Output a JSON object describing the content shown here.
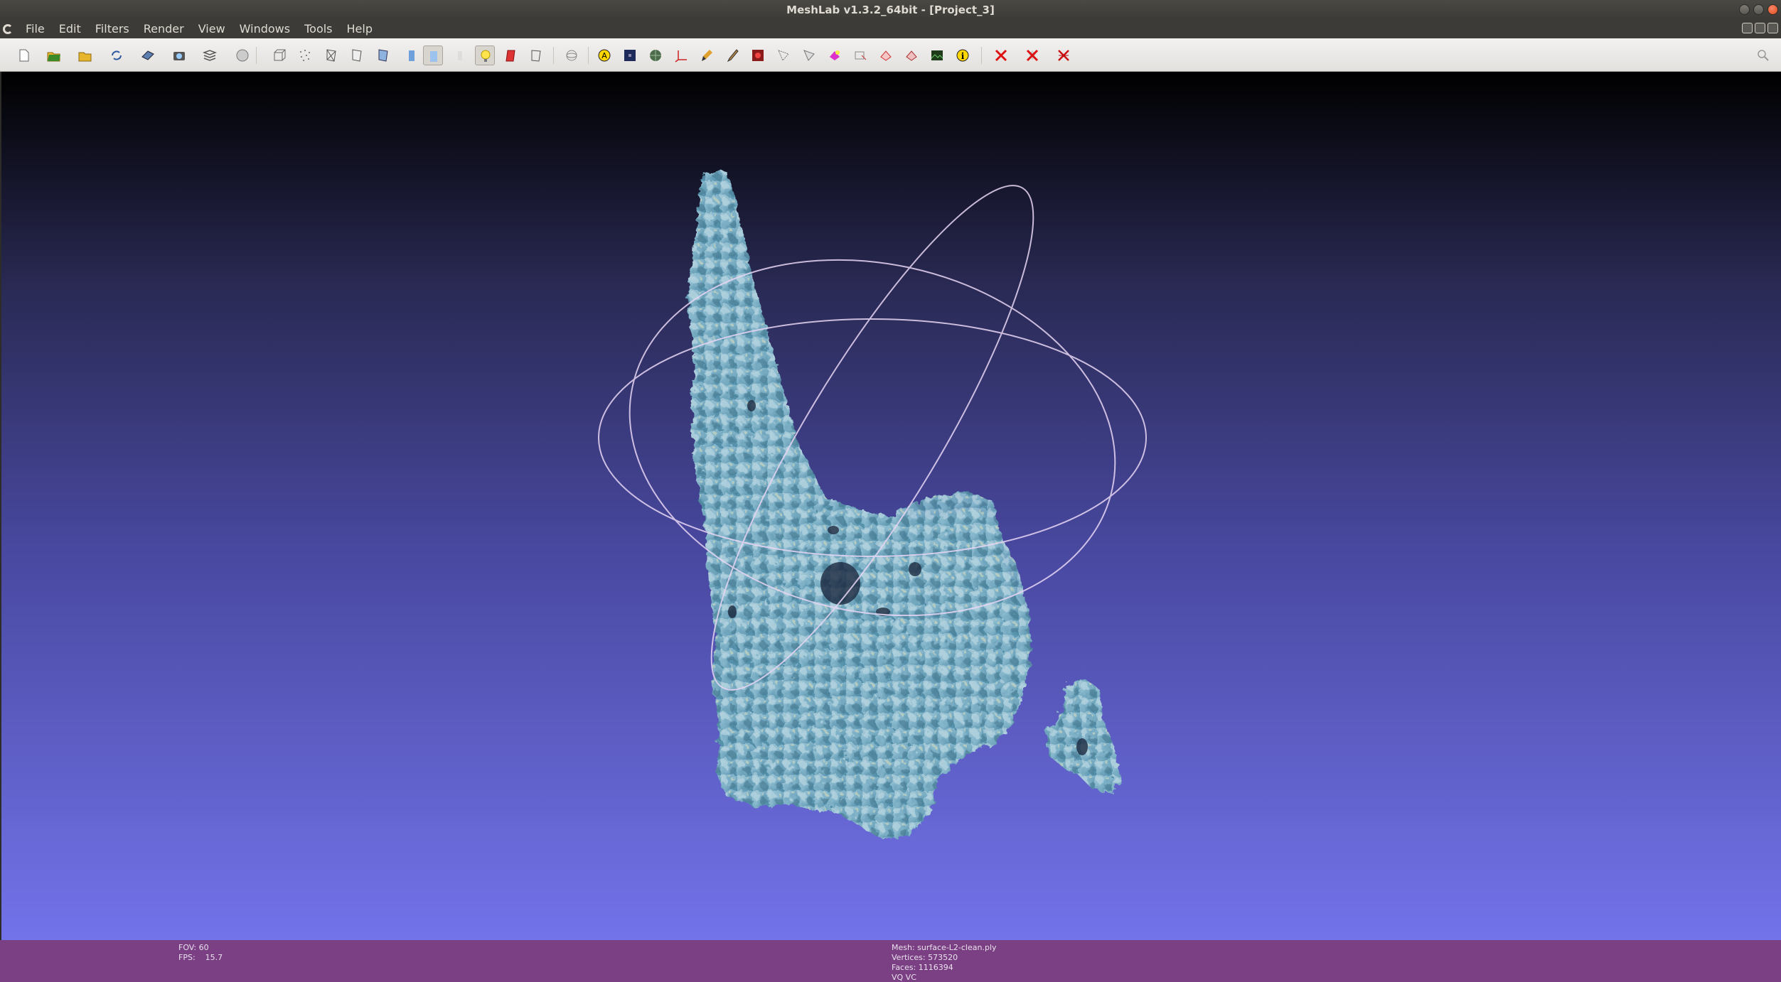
{
  "window": {
    "title": "MeshLab v1.3.2_64bit - [Project_3]"
  },
  "menu": {
    "items": [
      "File",
      "Edit",
      "Filters",
      "Render",
      "View",
      "Windows",
      "Tools",
      "Help"
    ]
  },
  "toolbar": {
    "buttons": [
      "new-project-icon",
      "open-project-icon",
      "import-mesh-icon",
      "reload-icon",
      "export-mesh-icon",
      "snapshot-icon",
      "layers-icon",
      "sphere-view-icon",
      "bounding-box-icon",
      "points-icon",
      "wireframe-icon",
      "hidden-lines-icon",
      "flat-lines-icon",
      "flat-icon",
      "smooth-icon",
      "texture-icon",
      "light-icon",
      "double-side-lighting-icon",
      "face-culling-icon",
      "trackball-icon",
      "text-annotation-icon",
      "dark-square-icon",
      "texture-grid-icon",
      "axis-icon",
      "brush-icon",
      "paint-icon",
      "color-picker-icon",
      "select-vertices-icon",
      "select-faces-icon",
      "color-faces-icon",
      "select-connected-icon",
      "measure-icon",
      "align-icon",
      "raster-icon",
      "info-icon",
      "delete-selected-vertices-icon",
      "delete-selected-faces-icon",
      "delete-all-icon",
      "search-icon"
    ],
    "active": [
      "flat-lines-icon",
      "light-icon"
    ]
  },
  "viewport": {
    "background_top": "#000000",
    "background_bottom": "#7373ea",
    "mesh_color": "#7fb3c9",
    "trackball_color": "#e8d6f4"
  },
  "status": {
    "fov_label": "FOV:",
    "fov_value": "60",
    "fps_label": "FPS:",
    "fps_value": "15.7",
    "mesh": "Mesh: surface-L2-clean.ply",
    "vertices": "Vertices: 573520",
    "faces": "Faces: 1116394",
    "mode": "VQ VC",
    "background": "#7b3f83"
  }
}
